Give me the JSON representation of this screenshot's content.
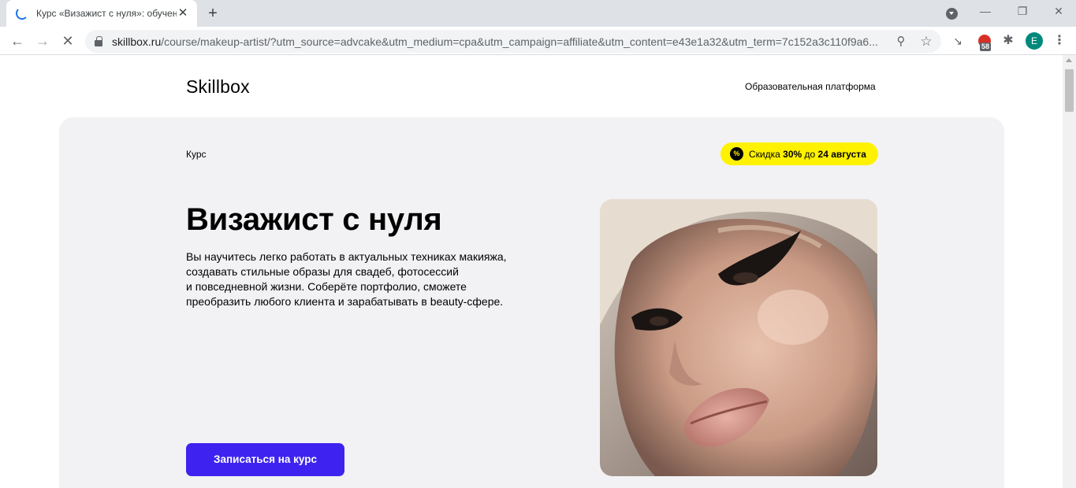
{
  "browser": {
    "tab_title": "Курс «Визажист с нуля»: обучение",
    "url_host": "skillbox.ru",
    "url_path": "/course/makeup-artist/?utm_source=advcake&utm_medium=cpa&utm_campaign=affiliate&utm_content=e43e1a32&utm_term=7c152a3c110f9a6...",
    "extension_badge": "58",
    "profile_initial": "E"
  },
  "header": {
    "logo": "Skillbox",
    "platform_label": "Образовательная платформа"
  },
  "hero": {
    "course_label": "Курс",
    "discount": {
      "icon_glyph": "%",
      "prefix": "Скидка ",
      "amount": "30%",
      "middle": " до ",
      "date": "24 августа"
    },
    "title": "Визажист с нуля",
    "description_lines": [
      "Вы научитесь легко работать в актуальных техниках макияжа,",
      "создавать стильные образы для свадеб, фотосессий",
      "и повседневной жизни. Соберёте портфолио, сможете",
      "преобразить любого клиента и зарабатывать в beauty-сфере."
    ],
    "cta_label": "Записаться на курс"
  },
  "colors": {
    "accent": "#3e23f0",
    "discount_bg": "#fff200",
    "hero_bg": "#f2f2f4"
  }
}
